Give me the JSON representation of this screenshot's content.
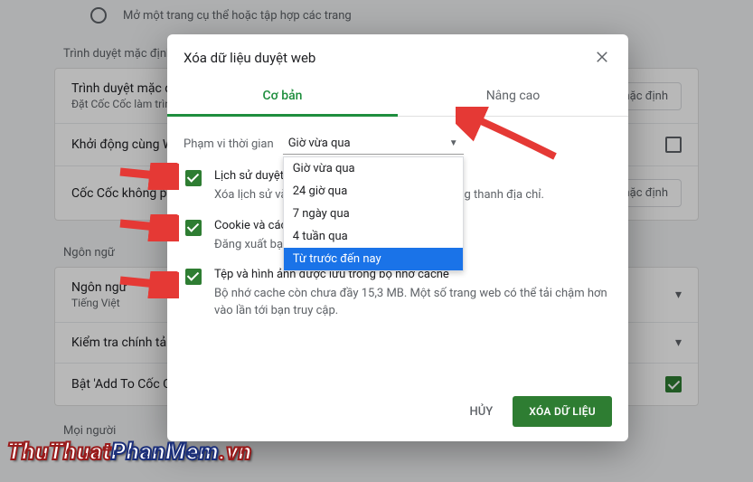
{
  "bg": {
    "radio_label": "Mở một trang cụ thể hoặc tập hợp các trang",
    "section_browser": "Trình duyệt mặc định",
    "default_browser_title": "Trình duyệt mặc định",
    "default_browser_sub": "Đặt Cốc Cốc làm trình duyệt mặc định",
    "default_button": "Đặt mặc định",
    "startup_title": "Khởi động cùng Windows",
    "coccoc_default_title": "Cốc Cốc không phải là trình duyệt mặc định",
    "section_language": "Ngôn ngữ",
    "language_title": "Ngôn ngữ",
    "language_value": "Tiếng Việt",
    "spellcheck_title": "Kiểm tra chính tả",
    "addto_title": "Bật 'Add To Cốc Cốc'",
    "section_people": "Mọi người"
  },
  "dialog": {
    "title": "Xóa dữ liệu duyệt web",
    "tab_basic": "Cơ bản",
    "tab_advanced": "Nâng cao",
    "range_label": "Phạm vi thời gian",
    "range_selected": "Giờ vừa qua",
    "range_options": [
      "Giờ vừa qua",
      "24 giờ qua",
      "7 ngày qua",
      "4 tuần qua",
      "Từ trước đến nay"
    ],
    "opt1_title": "Lịch sử duyệt web",
    "opt1_desc": "Xóa lịch sử và nội dung tự động hoàn thành trong thanh địa chỉ.",
    "opt2_title": "Cookie và các dữ liệu trang web khác",
    "opt2_desc": "Đăng xuất bạn khỏi hầu hết các trang web.",
    "opt3_title": "Tệp và hình ảnh được lưu trong bộ nhớ cache",
    "opt3_desc": "Bộ nhớ cache còn chưa đầy 15,3 MB. Một số trang web có thể tải chậm hơn vào lần tới bạn truy cập.",
    "cancel": "HỦY",
    "submit": "XÓA DỮ LIỆU"
  },
  "watermark": {
    "a": "ThuThuat",
    "b": "PhanMem",
    "c": ".vn"
  }
}
